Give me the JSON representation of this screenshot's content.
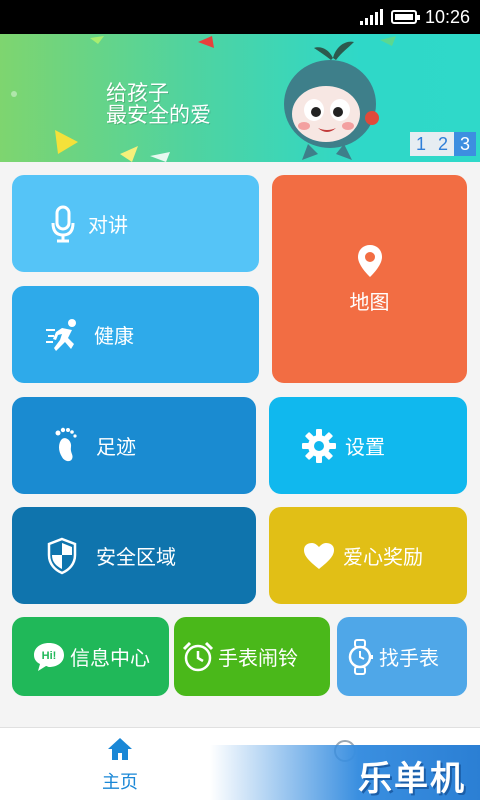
{
  "status_bar": {
    "time": "10:26"
  },
  "banner": {
    "slogan_line1": "给孩子",
    "slogan_line2": "最安全的爱",
    "pages": [
      "1",
      "2",
      "3"
    ],
    "active_page": 3
  },
  "tiles": {
    "intercom": "对讲",
    "map": "地图",
    "health": "健康",
    "footprints": "足迹",
    "settings": "设置",
    "safe_zone": "安全区域",
    "love_reward": "爱心奖励",
    "message_center": "信息中心",
    "watch_alarm": "手表闹铃",
    "find_watch": "找手表"
  },
  "icons": {
    "intercom": "microphone-icon",
    "map": "location-pin-icon",
    "health": "running-person-icon",
    "footprints": "footprint-icon",
    "settings": "gear-icon",
    "safe_zone": "shield-icon",
    "love_reward": "heart-icon",
    "message_center": "hi-chat-bubble-icon",
    "watch_alarm": "alarm-clock-icon",
    "find_watch": "wristwatch-icon",
    "home": "home-icon"
  },
  "colors": {
    "intercom": "#55c4f7",
    "map": "#f26d43",
    "health": "#2eaaea",
    "footprints": "#1a8bd1",
    "settings": "#10b8ee",
    "safe_zone": "#0f74ad",
    "love_reward": "#e1bf16",
    "message_center": "#20b859",
    "watch_alarm": "#4ab81a",
    "find_watch": "#4fa7e8",
    "tab_active": "#1a87d6"
  },
  "bottom_nav": {
    "home_label": "主页"
  },
  "watermark": "乐单机"
}
